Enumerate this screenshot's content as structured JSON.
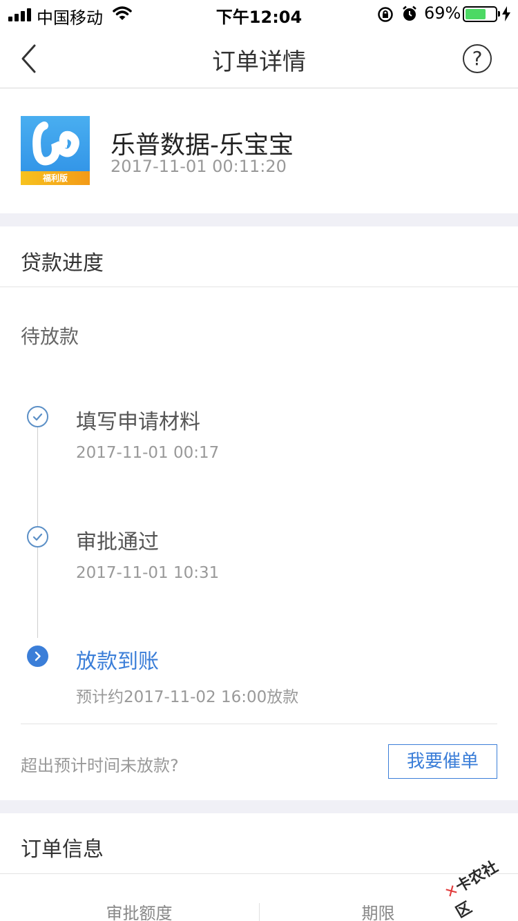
{
  "status_bar": {
    "carrier": "中国移动",
    "time": "下午12:04",
    "battery_percent": "69%",
    "battery_level": 0.69
  },
  "nav": {
    "title": "订单详情",
    "help_label": "?"
  },
  "merchant": {
    "name": "乐普数据-乐宝宝",
    "time": "2017-11-01 00:11:20",
    "logo_badge": "福利版"
  },
  "progress": {
    "section_title": "贷款进度",
    "status": "待放款",
    "steps": [
      {
        "title": "填写申请材料",
        "subtitle": "2017-11-01 00:17",
        "state": "done"
      },
      {
        "title": "审批通过",
        "subtitle": "2017-11-01 10:31",
        "state": "done"
      },
      {
        "title": "放款到账",
        "subtitle": "预计约2017-11-02 16:00放款",
        "state": "current"
      }
    ],
    "urge_question": "超出预计时间未放款?",
    "urge_button": "我要催单"
  },
  "order_info": {
    "section_title": "订单信息",
    "columns": [
      "审批额度",
      "期限"
    ]
  },
  "watermark": "卡农社区",
  "colors": {
    "accent": "#3b7ed8",
    "section_gap": "#f0f0f6",
    "battery": "#4cd964"
  }
}
